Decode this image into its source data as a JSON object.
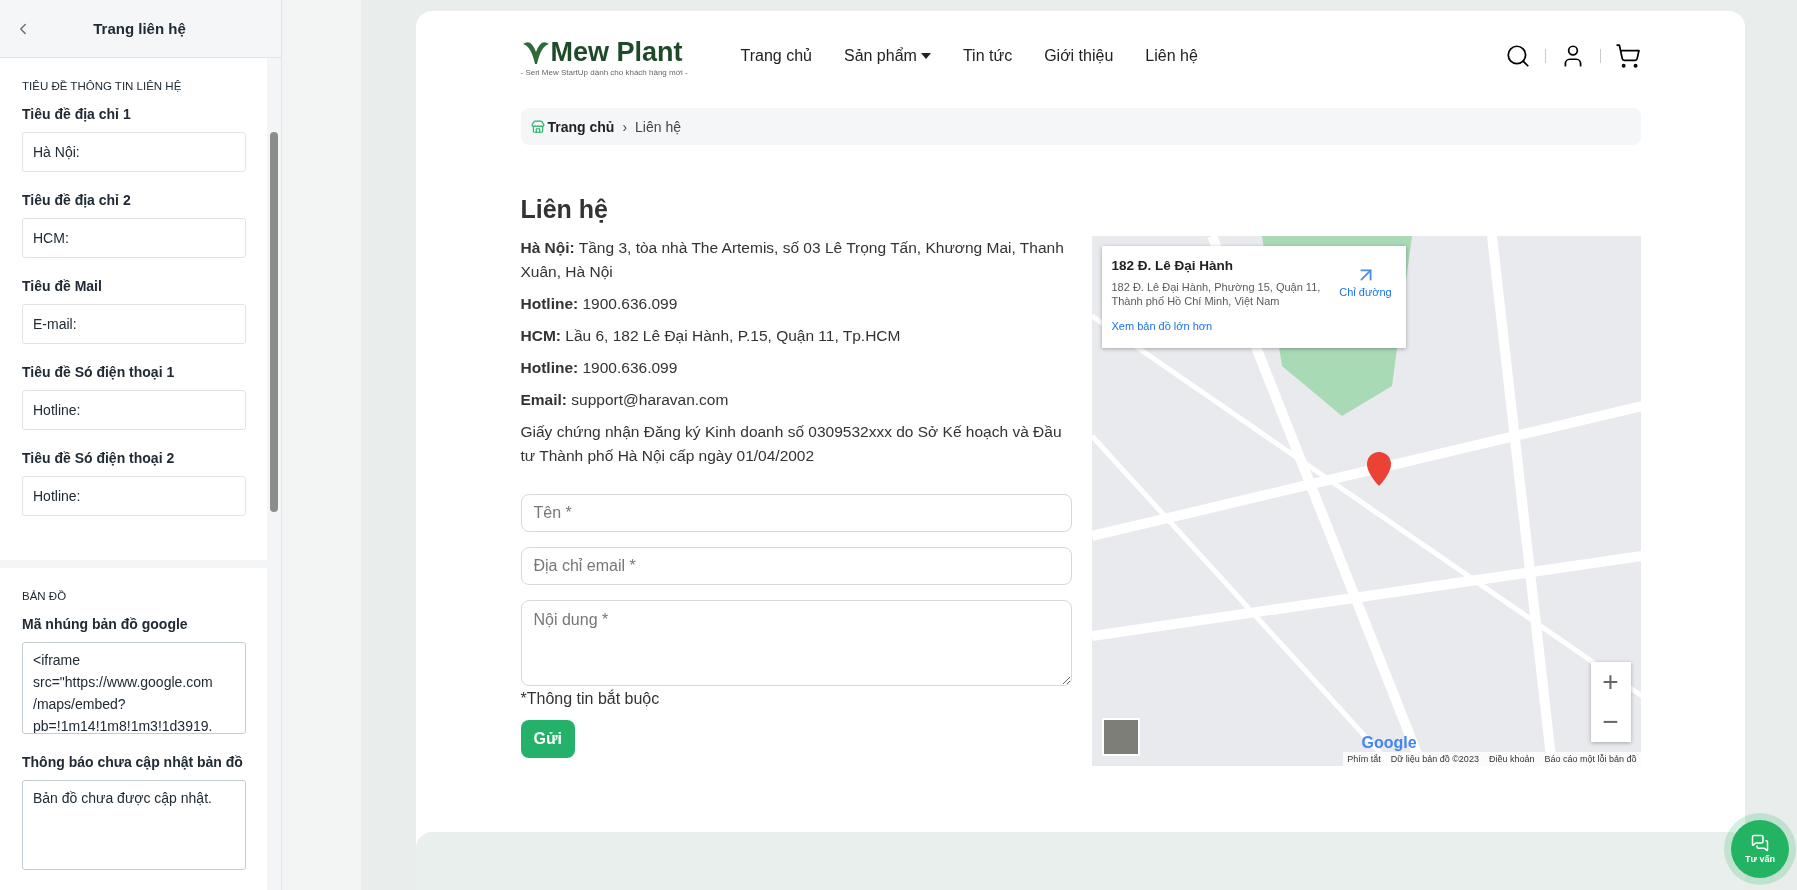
{
  "sidebar": {
    "title": "Trang liên hệ",
    "sections": [
      {
        "heading": "TIÊU ĐỀ THÔNG TIN LIÊN HỆ",
        "fields": [
          {
            "kind": "input",
            "label": "Tiêu đề địa chỉ 1",
            "value": "Hà Nội:"
          },
          {
            "kind": "input",
            "label": "Tiêu đề địa chỉ 2",
            "value": "HCM:"
          },
          {
            "kind": "input",
            "label": "Tiêu đề Mail",
            "value": "E-mail:"
          },
          {
            "kind": "input",
            "label": "Tiêu đề Só điện thoại 1",
            "value": "Hotline:"
          },
          {
            "kind": "input",
            "label": "Tiêu đề Só điện thoại 2",
            "value": "Hotline:"
          }
        ]
      },
      {
        "heading": "BẢN ĐỒ",
        "fields": [
          {
            "kind": "code",
            "label": "Mã nhúng bản đồ google",
            "value": "<iframe\nsrc=\"https://www.google.com\n/maps/embed?\npb=!1m14!1m8!1m3!1d3919."
          },
          {
            "kind": "textarea",
            "label": "Thông báo chưa cập nhật bản đồ",
            "value": "Bản đồ chưa được cập nhật."
          }
        ]
      }
    ]
  },
  "site": {
    "logo": {
      "name": "Mew Plant",
      "tagline": "- Seri Mew StartUp dành cho khách hàng mới -"
    },
    "nav": [
      {
        "label": "Trang chủ",
        "has_dropdown": false
      },
      {
        "label": "Sản phẩm",
        "has_dropdown": true
      },
      {
        "label": "Tin tức",
        "has_dropdown": false
      },
      {
        "label": "Giới thiệu",
        "has_dropdown": false
      },
      {
        "label": "Liên hệ",
        "has_dropdown": false
      }
    ],
    "breadcrumb": {
      "home": "Trang chủ",
      "separator": "›",
      "current": "Liên hệ"
    },
    "title": "Liên hệ",
    "contact_lines": [
      {
        "label": "Hà Nội:",
        "text": "Tầng 3, tòa nhà The Artemis, số 03 Lê Trọng Tấn, Khương Mai, Thanh Xuân, Hà Nội"
      },
      {
        "label": "Hotline:",
        "text": "1900.636.099"
      },
      {
        "label": "HCM:",
        "text": "Lầu 6, 182 Lê Đại Hành, P.15, Quận 11, Tp.HCM"
      },
      {
        "label": "Hotline:",
        "text": "1900.636.099"
      },
      {
        "label": "Email:",
        "text": "support@haravan.com"
      }
    ],
    "license": "Giấy chứng nhận Đăng ký Kinh doanh số 0309532xxx do Sở Kế hoạch và Đầu tư Thành phố Hà Nội cấp ngày 01/04/2002",
    "form": {
      "fields": [
        {
          "kind": "input",
          "placeholder": "Tên *"
        },
        {
          "kind": "input",
          "placeholder": "Địa chỉ email *"
        },
        {
          "kind": "textarea",
          "placeholder": "Nội dung *"
        }
      ],
      "required_note": "*Thông tin bắt buộc",
      "submit": "Gửi"
    },
    "map": {
      "place_title": "182 Đ. Lê Đại Hành",
      "place_address": "182 Đ. Lê Đại Hành, Phường 15, Quận 11, Thành phố Hồ Chí Minh, Việt Nam",
      "directions": "Chỉ đường",
      "larger_map": "Xem bản đồ lớn hơn",
      "zoom_in": "+",
      "zoom_out": "−",
      "google": "Google",
      "footer_links": [
        "Phím tắt",
        "Dữ liệu bản đồ ©2023",
        "Điều khoản",
        "Báo cáo một lỗi bản đồ"
      ]
    },
    "chat_button": "Tư vấn"
  }
}
